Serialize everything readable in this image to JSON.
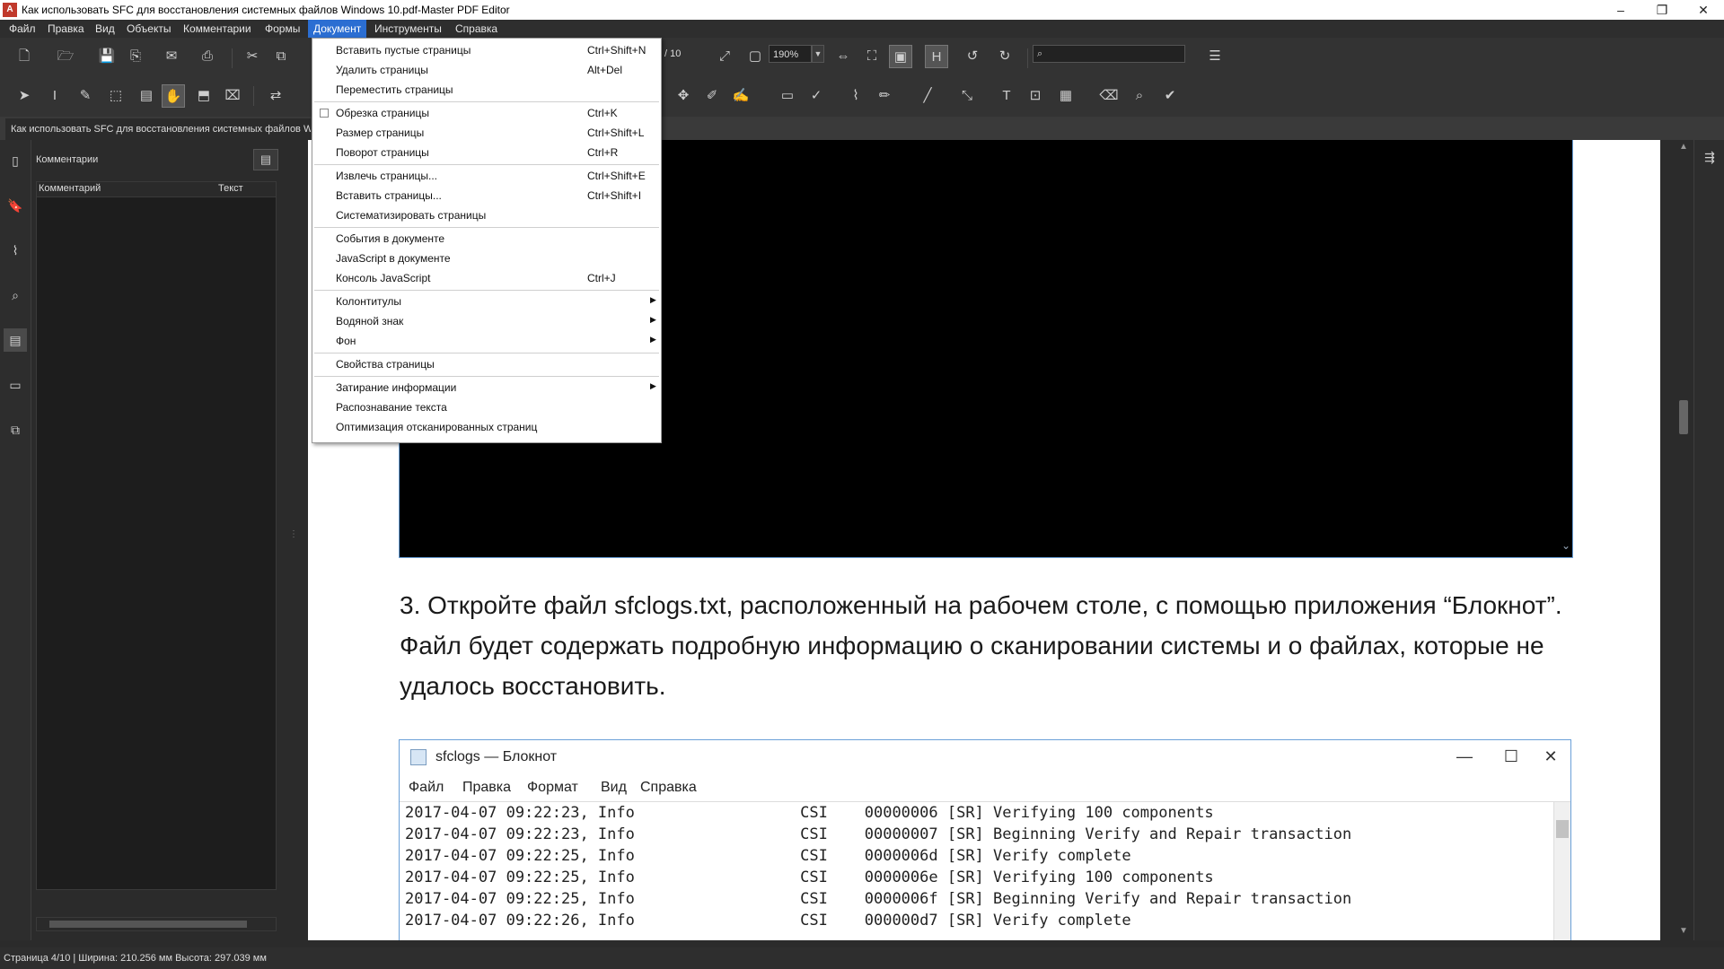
{
  "window": {
    "title": "Как использовать SFC для восстановления системных файлов Windows 10.pdf-Master PDF Editor",
    "app_icon": "pdf-app-icon",
    "minimize": "–",
    "restore": "❐",
    "close": "✕"
  },
  "menubar": {
    "items": [
      "Файл",
      "Правка",
      "Вид",
      "Объекты",
      "Комментарии",
      "Формы",
      "Документ",
      "Инструменты",
      "Справка"
    ],
    "active": "Документ"
  },
  "toolbar": {
    "page_count": "/ 10",
    "zoom": "190%",
    "search_icon": "⌕"
  },
  "tab": {
    "label": "Как использовать SFC для восстановления системных файлов Windows 10.pdf"
  },
  "comments_panel": {
    "title": "Комментарии",
    "col_comment": "Комментарий",
    "col_text": "Текст"
  },
  "document_menu": {
    "items": [
      {
        "label": "Вставить пустые страницы",
        "shortcut": "Ctrl+Shift+N"
      },
      {
        "label": "Удалить страницы",
        "shortcut": "Alt+Del"
      },
      {
        "label": "Переместить страницы",
        "shortcut": ""
      },
      {
        "label": "Обрезка страницы",
        "shortcut": "Ctrl+K"
      },
      {
        "label": "Размер страницы",
        "shortcut": "Ctrl+Shift+L"
      },
      {
        "label": "Поворот страницы",
        "shortcut": "Ctrl+R"
      },
      {
        "label": "Извлечь страницы...",
        "shortcut": "Ctrl+Shift+E"
      },
      {
        "label": "Вставить страницы...",
        "shortcut": "Ctrl+Shift+I"
      },
      {
        "label": "Систематизировать страницы",
        "shortcut": ""
      },
      {
        "label": "События в документе",
        "shortcut": ""
      },
      {
        "label": "JavaScript в документе",
        "shortcut": ""
      },
      {
        "label": "Консоль JavaScript",
        "shortcut": "Ctrl+J"
      },
      {
        "label": "Колонтитулы",
        "shortcut": ""
      },
      {
        "label": "Водяной знак",
        "shortcut": ""
      },
      {
        "label": "Фон",
        "shortcut": ""
      },
      {
        "label": "Свойства страницы",
        "shortcut": ""
      },
      {
        "label": "Затирание информации",
        "shortcut": ""
      },
      {
        "label": "Распознавание текста",
        "shortcut": ""
      },
      {
        "label": "Оптимизация отсканированных страниц",
        "shortcut": ""
      }
    ]
  },
  "document": {
    "paragraph": "3. Откройте файл sfclogs.txt, расположенный на рабочем столе, с помощью приложения “Блокнот”. Файл будет содержать подробную информацию о сканировании системы и о файлах, которые не удалось восстановить."
  },
  "notepad": {
    "title": "sfclogs — Блокнот",
    "minimize": "—",
    "maximize": "☐",
    "close": "✕",
    "menu": [
      "Файл",
      "Правка",
      "Формат",
      "Вид",
      "Справка"
    ],
    "lines": [
      "2017-04-07 09:22:23, Info                  CSI    00000006 [SR] Verifying 100 components",
      "2017-04-07 09:22:23, Info                  CSI    00000007 [SR] Beginning Verify and Repair transaction",
      "2017-04-07 09:22:25, Info                  CSI    0000006d [SR] Verify complete",
      "2017-04-07 09:22:25, Info                  CSI    0000006e [SR] Verifying 100 components",
      "2017-04-07 09:22:25, Info                  CSI    0000006f [SR] Beginning Verify and Repair transaction",
      "2017-04-07 09:22:26, Info                  CSI    000000d7 [SR] Verify complete"
    ]
  },
  "statusbar": {
    "text": "Страница 4/10 | Ширина: 210.256 мм Высота: 297.039 мм"
  }
}
